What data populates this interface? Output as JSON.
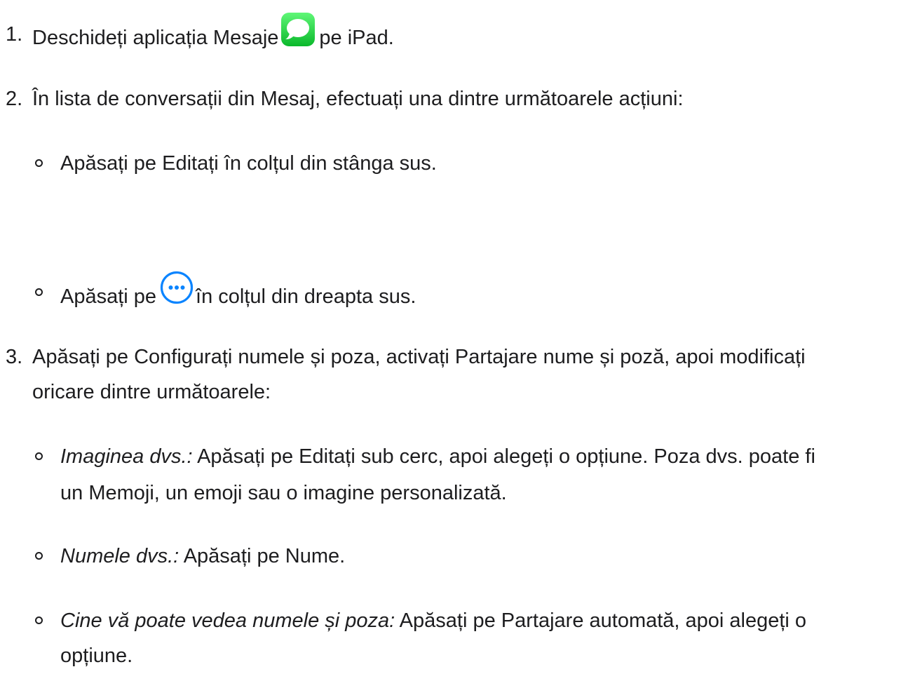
{
  "steps": [
    {
      "number": "1.",
      "text_before": "Deschideți aplicația Mesaje",
      "icon": "messages-app-icon",
      "text_after": "pe iPad."
    },
    {
      "number": "2.",
      "text": "În lista de conversații din Mesaj, efectuați una dintre următoarele acțiuni:",
      "options": [
        {
          "text": "Apăsați pe Editați în colțul din stânga sus."
        },
        {
          "text_before": "Apăsați pe",
          "icon": "more-ellipsis-circle-icon",
          "text_after": "în colțul din dreapta sus."
        }
      ]
    },
    {
      "number": "3.",
      "text_lines": [
        "Apăsați pe Configurați numele și poza, activați Partajare nume și poză, apoi modificați",
        "oricare dintre următoarele:"
      ],
      "options": [
        {
          "lead": "Imaginea dvs.:",
          "text_lines": [
            "Apăsați pe Editați sub cerc, apoi alegeți o opțiune. Poza dvs. poate fi",
            "un Memoji, un emoji sau o imagine personalizată."
          ]
        },
        {
          "lead": "Numele dvs.:",
          "text": "Apăsați pe Nume."
        },
        {
          "lead": "Cine vă poate vedea numele și poza:",
          "text_lines": [
            "Apăsați pe Partajare automată, apoi alegeți o",
            "opțiune."
          ]
        }
      ]
    }
  ],
  "colors": {
    "text": "#1d1d1f",
    "messages_green_top": "#5ff777",
    "messages_green_bottom": "#0ab82b",
    "accent_blue": "#0a84ff"
  }
}
